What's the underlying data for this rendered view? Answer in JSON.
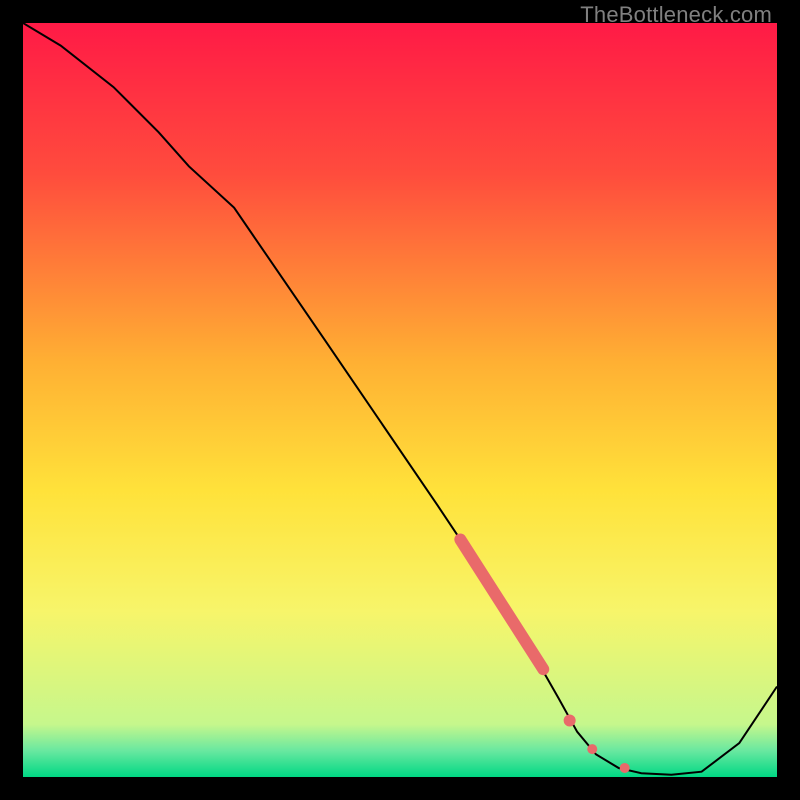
{
  "watermark": "TheBottleneck.com",
  "chart_data": {
    "type": "line",
    "title": "",
    "xlabel": "",
    "ylabel": "",
    "xlim": [
      0,
      100
    ],
    "ylim": [
      0,
      100
    ],
    "grid": false,
    "legend": false,
    "background_gradient": {
      "top_color": "#ff1a46",
      "mid_color": "#ffd700",
      "bottom_color": "#00e08a",
      "stops": [
        {
          "pos": 0.0,
          "color": "#ff1a46"
        },
        {
          "pos": 0.2,
          "color": "#ff4c3d"
        },
        {
          "pos": 0.45,
          "color": "#ffb033"
        },
        {
          "pos": 0.62,
          "color": "#ffe23a"
        },
        {
          "pos": 0.78,
          "color": "#f7f56a"
        },
        {
          "pos": 0.93,
          "color": "#c6f78c"
        },
        {
          "pos": 0.965,
          "color": "#69e8a0"
        },
        {
          "pos": 1.0,
          "color": "#00d884"
        }
      ]
    },
    "series": [
      {
        "name": "curve",
        "color": "#000000",
        "stroke_width": 2,
        "x": [
          0.0,
          5.0,
          12.0,
          18.0,
          22.0,
          28.0,
          40.0,
          55.0,
          62.0,
          67.0,
          71.0,
          73.5,
          76.0,
          79.0,
          82.0,
          86.0,
          90.0,
          95.0,
          100.0
        ],
        "y": [
          100.0,
          97.0,
          91.5,
          85.5,
          81.0,
          75.5,
          58.0,
          36.0,
          25.5,
          17.5,
          10.5,
          6.0,
          3.0,
          1.2,
          0.5,
          0.3,
          0.7,
          4.5,
          12.0
        ]
      }
    ],
    "highlights": [
      {
        "name": "thick-segment",
        "type": "line-segment",
        "color": "#e96a6a",
        "stroke_width": 12,
        "linecap": "round",
        "x": [
          58.0,
          69.0
        ],
        "y": [
          31.5,
          14.3
        ]
      },
      {
        "name": "dot-1",
        "type": "point",
        "color": "#e96a6a",
        "radius": 6,
        "x": 72.5,
        "y": 7.5
      },
      {
        "name": "dot-2",
        "type": "point",
        "color": "#e96a6a",
        "radius": 5,
        "x": 75.5,
        "y": 3.7
      },
      {
        "name": "dot-3",
        "type": "point",
        "color": "#e96a6a",
        "radius": 5,
        "x": 79.8,
        "y": 1.2
      }
    ]
  }
}
